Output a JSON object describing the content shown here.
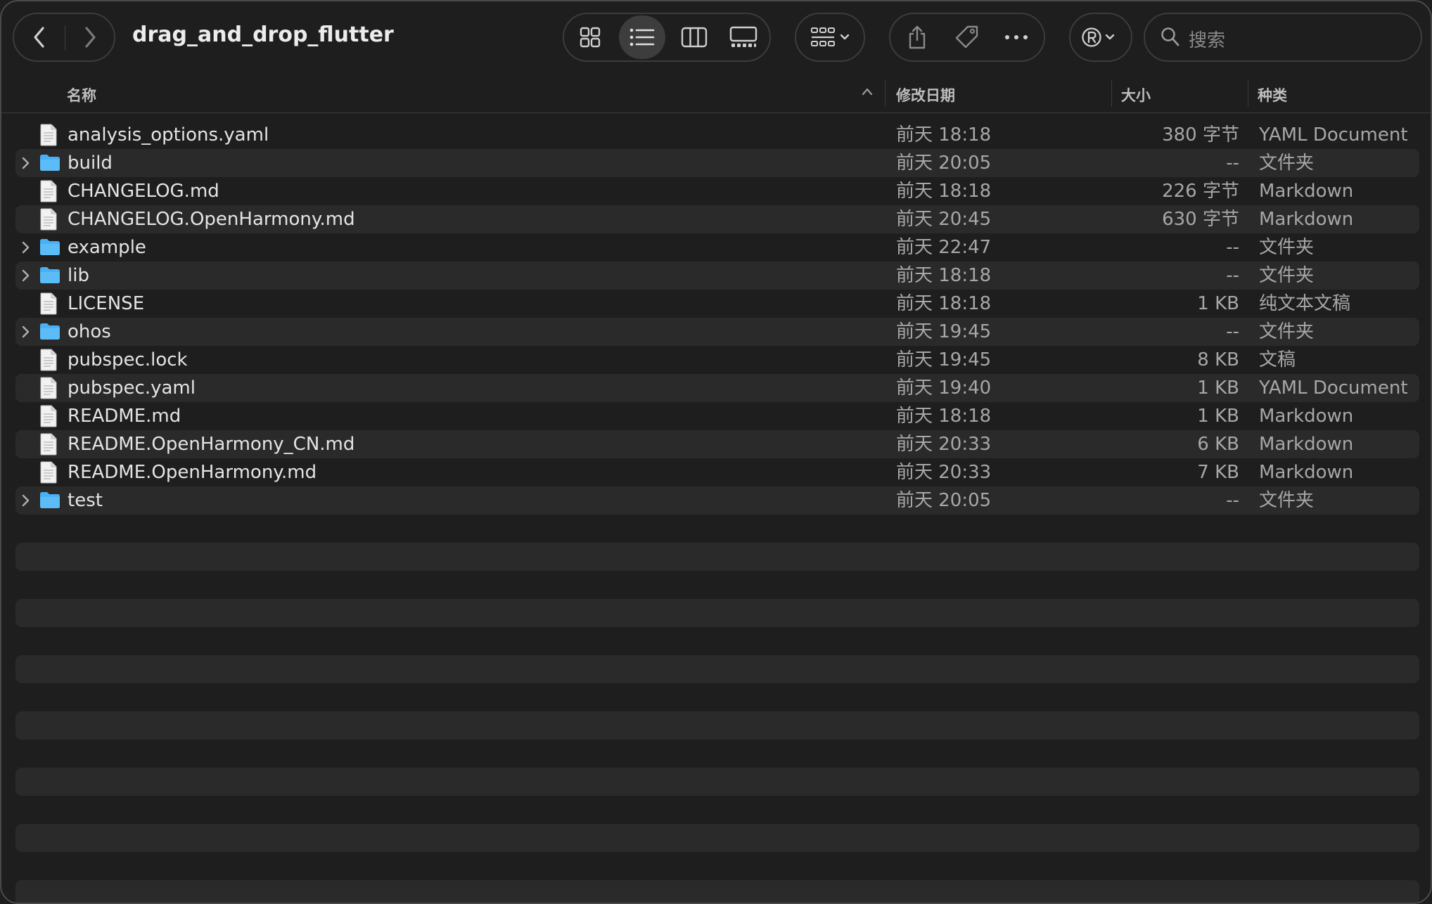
{
  "window": {
    "title": "drag_and_drop_flutter"
  },
  "toolbar": {
    "back_icon": "chevron-left-icon",
    "forward_icon": "chevron-right-icon",
    "view_icons": [
      "icon-view-icon",
      "list-view-icon",
      "column-view-icon",
      "gallery-view-icon"
    ],
    "active_view": "list-view-icon",
    "group_icon": "group-by-icon",
    "share_icon": "share-icon",
    "tag_icon": "tag-icon",
    "more_icon": "more-icon",
    "account_icon": "registered-icon",
    "search_placeholder": "搜索"
  },
  "columns": {
    "name": "名称",
    "date": "修改日期",
    "size": "大小",
    "kind": "种类"
  },
  "colors": {
    "folder": "#4ab0f5",
    "row_alt": "#2a2a2a",
    "background": "#1e1e1e"
  },
  "files": [
    {
      "name": "analysis_options.yaml",
      "date": "前天 18:18",
      "size": "380 字节",
      "kind": "YAML Document",
      "type": "file"
    },
    {
      "name": "build",
      "date": "前天 20:05",
      "size": "--",
      "kind": "文件夹",
      "type": "folder"
    },
    {
      "name": "CHANGELOG.md",
      "date": "前天 18:18",
      "size": "226 字节",
      "kind": "Markdown",
      "type": "file"
    },
    {
      "name": "CHANGELOG.OpenHarmony.md",
      "date": "前天 20:45",
      "size": "630 字节",
      "kind": "Markdown",
      "type": "file"
    },
    {
      "name": "example",
      "date": "前天 22:47",
      "size": "--",
      "kind": "文件夹",
      "type": "folder"
    },
    {
      "name": "lib",
      "date": "前天 18:18",
      "size": "--",
      "kind": "文件夹",
      "type": "folder"
    },
    {
      "name": "LICENSE",
      "date": "前天 18:18",
      "size": "1 KB",
      "kind": "纯文本文稿",
      "type": "file"
    },
    {
      "name": "ohos",
      "date": "前天 19:45",
      "size": "--",
      "kind": "文件夹",
      "type": "folder"
    },
    {
      "name": "pubspec.lock",
      "date": "前天 19:45",
      "size": "8 KB",
      "kind": "文稿",
      "type": "file"
    },
    {
      "name": "pubspec.yaml",
      "date": "前天 19:40",
      "size": "1 KB",
      "kind": "YAML Document",
      "type": "file"
    },
    {
      "name": "README.md",
      "date": "前天 18:18",
      "size": "1 KB",
      "kind": "Markdown",
      "type": "file"
    },
    {
      "name": "README.OpenHarmony_CN.md",
      "date": "前天 20:33",
      "size": "6 KB",
      "kind": "Markdown",
      "type": "file"
    },
    {
      "name": "README.OpenHarmony.md",
      "date": "前天 20:33",
      "size": "7 KB",
      "kind": "Markdown",
      "type": "file"
    },
    {
      "name": "test",
      "date": "前天 20:05",
      "size": "--",
      "kind": "文件夹",
      "type": "folder"
    }
  ]
}
